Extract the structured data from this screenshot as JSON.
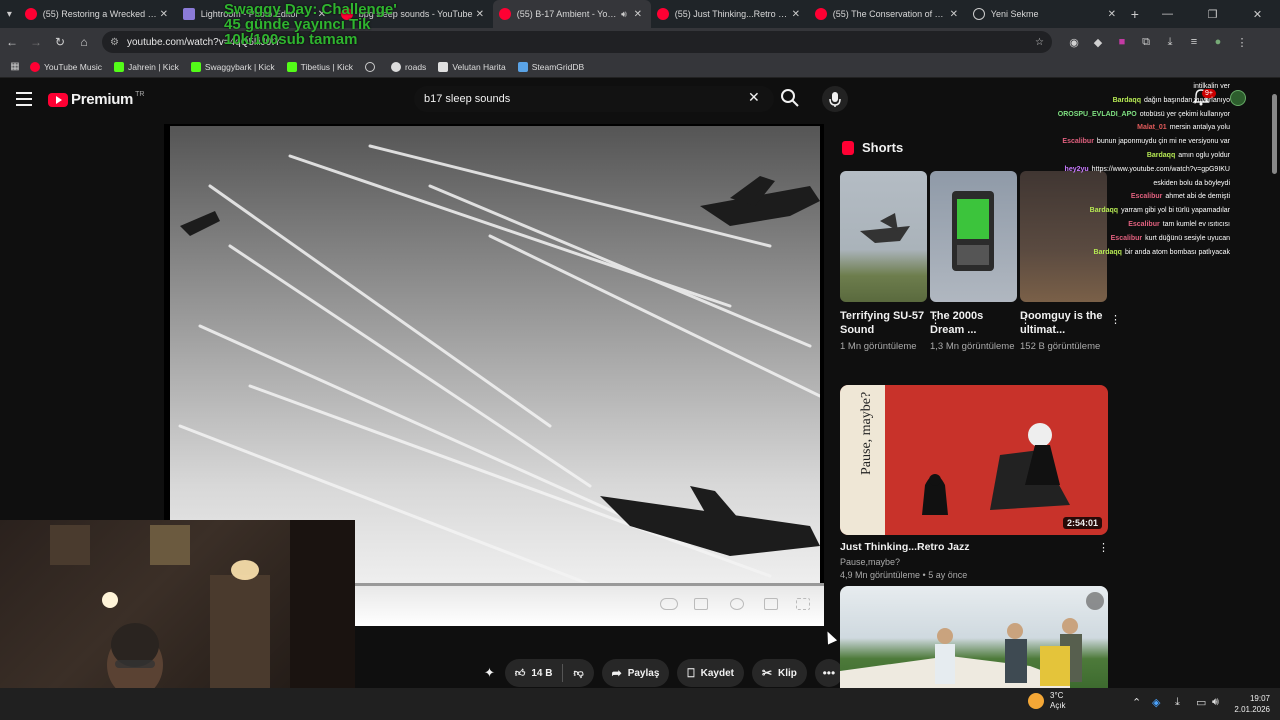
{
  "browser": {
    "tabs": [
      {
        "title": "(55) Restoring a Wrecked Ome",
        "favicon": "youtube-icon",
        "active": false
      },
      {
        "title": "Lightroom - Photo Editor",
        "favicon": "pen-icon",
        "active": false
      },
      {
        "title": "bpg sleep sounds - YouTube",
        "favicon": "youtube-icon",
        "active": false
      },
      {
        "title": "(55) B-17 Ambient - YouTub",
        "favicon": "youtube-icon",
        "active": true,
        "audio": true
      },
      {
        "title": "(55) Just Thinking...Retro Jazz",
        "favicon": "youtube-icon",
        "active": false
      },
      {
        "title": "(55) The Conservation of The A",
        "favicon": "youtube-icon",
        "active": false
      },
      {
        "title": "Yeni Sekme",
        "favicon": "globe-icon",
        "active": false
      }
    ],
    "url": "youtube.com/watch?v=4qQ5lliJ0tY",
    "bookmarks": [
      {
        "label": "YouTube Music",
        "icon": "yt"
      },
      {
        "label": "Jahrein | Kick",
        "icon": "kick"
      },
      {
        "label": "Swaggybark | Kick",
        "icon": "kick"
      },
      {
        "label": "Tibetius | Kick",
        "icon": "kick"
      },
      {
        "label": "",
        "icon": "globe"
      },
      {
        "label": "roads",
        "icon": "road"
      },
      {
        "label": "Velutan Harita",
        "icon": "map"
      },
      {
        "label": "SteamGridDB",
        "icon": "steam"
      }
    ]
  },
  "overlay_text": "Swaggy Day: Challenge'\n45 günde yayıncı Tik\n10k/100sub tamam",
  "youtube": {
    "brand": "Premium",
    "country": "TR",
    "search_query": "b17 sleep sounds",
    "notification_badge": "9+",
    "actions": {
      "likes": "14 B",
      "share": "Paylaş",
      "save": "Kaydet",
      "clip": "Klip"
    },
    "shorts": {
      "heading": "Shorts",
      "items": [
        {
          "title": "Terrifying SU-57 Sound",
          "views": "1 Mn görüntüleme"
        },
        {
          "title": "The 2000s Dream ...",
          "views": "1,3 Mn görüntüleme"
        },
        {
          "title": "Doomguy is the ultimat...",
          "views": "152 B görüntüleme"
        }
      ]
    },
    "recommended": [
      {
        "title": "Just Thinking...Retro Jazz",
        "channel": "Pause,maybe?",
        "meta": "4,9 Mn görüntüleme • 5 ay önce",
        "duration": "2:54:01",
        "thumb_text": "Pause, maybe?"
      }
    ]
  },
  "chat": [
    {
      "user": "",
      "color": "#ffffff",
      "msg": "intilkalin ver"
    },
    {
      "user": "Bardaqq",
      "color": "#b5e853",
      "msg": "dağın başından yuvarlanıyo"
    },
    {
      "user": "OROSPU_EVLADI_APO",
      "color": "#7ee081",
      "msg": "otobüsü yer çekimi kullanıyor"
    },
    {
      "user": "Malat_01",
      "color": "#e05a5a",
      "msg": "mersin antalya yolu"
    },
    {
      "user": "Escalibur",
      "color": "#e0607e",
      "msg": "bunun japonmuydu çin mi ne versiyonu var"
    },
    {
      "user": "Bardaqq",
      "color": "#b5e853",
      "msg": "amın oglu yoldur"
    },
    {
      "user": "hey2yu",
      "color": "#c879ff",
      "msg": "https://www.youtube.com/watch?v=gpG9IKU"
    },
    {
      "user": "",
      "color": "#ffffff",
      "msg": "eskiden bolu da böyleydi"
    },
    {
      "user": "Escalibur",
      "color": "#e0607e",
      "msg": "ahmet abi de demişti"
    },
    {
      "user": "Bardaqq",
      "color": "#b5e853",
      "msg": "yarram gibi yol bi türlü yapamadılar"
    },
    {
      "user": "Escalibur",
      "color": "#e0607e",
      "msg": "tam kumlel ev ısıtıcısı"
    },
    {
      "user": "Escalibur",
      "color": "#e0607e",
      "msg": "kurt düğünü sesiyle uyucan"
    },
    {
      "user": "Bardaqq",
      "color": "#b5e853",
      "msg": "bir anda atom bombası patlıyacak"
    }
  ],
  "taskbar": {
    "weather_temp": "3°C",
    "weather_desc": "Açık",
    "time": "19:07",
    "date": "2.01.2026"
  },
  "colors": {
    "accent": "#ff0033",
    "background": "#0f0f0f",
    "pill": "#272727"
  }
}
